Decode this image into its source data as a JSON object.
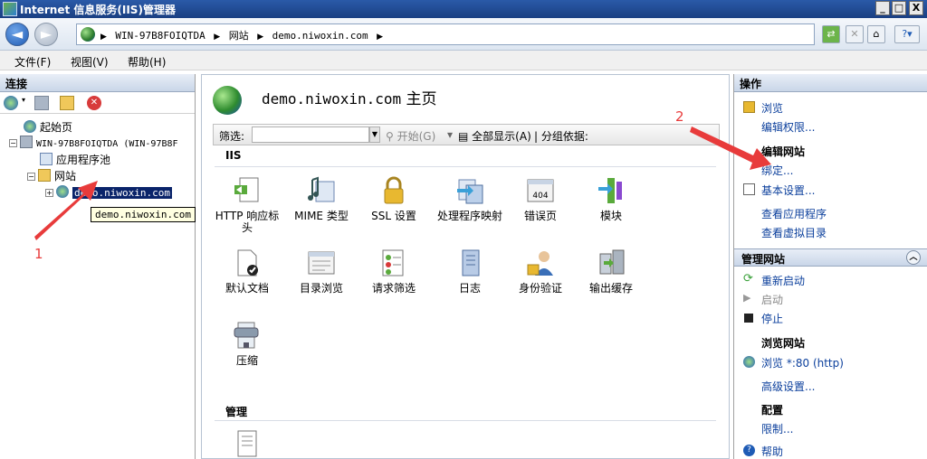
{
  "window": {
    "title": "Internet 信息服务(IIS)管理器",
    "controls": {
      "minimize": "_",
      "maximize": "□",
      "close": "X"
    }
  },
  "address": {
    "crumbs": [
      "WIN-97B8FOIQTDA",
      "网站",
      "demo.niwoxin.com"
    ]
  },
  "menu": [
    "文件(F)",
    "视图(V)",
    "帮助(H)"
  ],
  "left": {
    "header": "连接",
    "tree": {
      "start_page": "起始页",
      "server": "WIN-97B8FOIQTDA (WIN-97B8F",
      "app_pools": "应用程序池",
      "sites": "网站",
      "site": "demo.niwoxin.com"
    },
    "tooltip": "demo.niwoxin.com"
  },
  "center": {
    "title_site": "demo.niwoxin.com",
    "title_suffix": "主页",
    "filter": {
      "label": "筛选:",
      "start": "开始(G)",
      "show_all": "全部显示(A)",
      "group_by": "分组依据:"
    },
    "section_iis": "IIS",
    "section_manage": "管理",
    "features": [
      {
        "label": "HTTP 响应标头",
        "icon": "http-headers-icon"
      },
      {
        "label": "MIME 类型",
        "icon": "mime-icon"
      },
      {
        "label": "SSL 设置",
        "icon": "lock-icon"
      },
      {
        "label": "处理程序映射",
        "icon": "handler-icon"
      },
      {
        "label": "错误页",
        "icon": "error-page-icon"
      },
      {
        "label": "模块",
        "icon": "modules-icon"
      },
      {
        "label": "默认文档",
        "icon": "default-doc-icon"
      },
      {
        "label": "目录浏览",
        "icon": "dir-browse-icon"
      },
      {
        "label": "请求筛选",
        "icon": "request-filter-icon"
      },
      {
        "label": "日志",
        "icon": "log-icon"
      },
      {
        "label": "身份验证",
        "icon": "auth-icon"
      },
      {
        "label": "输出缓存",
        "icon": "output-cache-icon"
      },
      {
        "label": "压缩",
        "icon": "compress-icon"
      }
    ],
    "error_badge": "404"
  },
  "right": {
    "header": "操作",
    "browse": "浏览",
    "edit_perms": "编辑权限...",
    "edit_site": "编辑网站",
    "bindings": "绑定...",
    "basic_settings": "基本设置...",
    "view_apps": "查看应用程序",
    "view_vdirs": "查看虚拟目录",
    "manage_site": "管理网站",
    "restart": "重新启动",
    "start": "启动",
    "stop": "停止",
    "browse_site": "浏览网站",
    "browse_port": "浏览 *:80 (http)",
    "advanced": "高级设置...",
    "config": "配置",
    "limits": "限制...",
    "help": "帮助"
  },
  "annotations": {
    "one": "1",
    "two": "2"
  },
  "colors": {
    "accent": "#0b3f9c",
    "arrow": "#e83b3b",
    "selected": "#0a246a"
  }
}
